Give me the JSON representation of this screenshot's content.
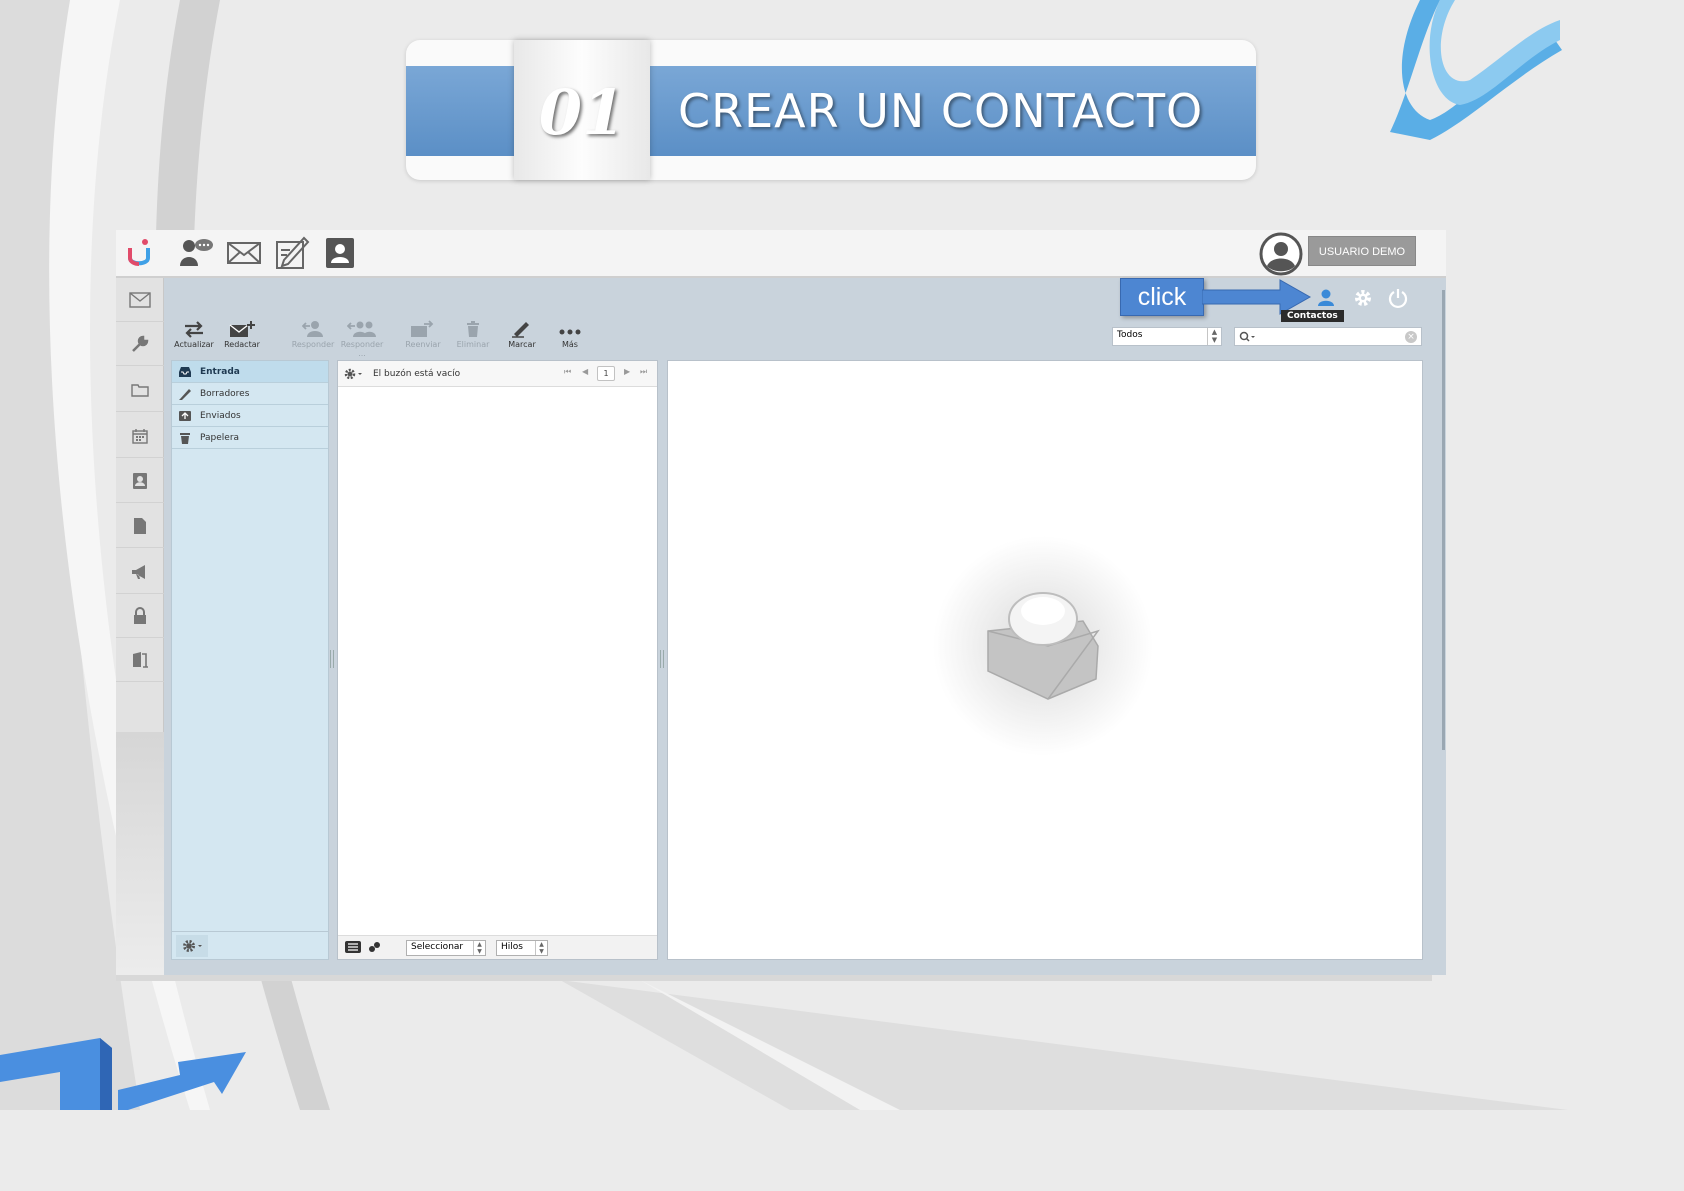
{
  "banner": {
    "number": "01",
    "title": "CREAR UN CONTACTO"
  },
  "topbar": {
    "icons": [
      "chat-icon",
      "mail-icon",
      "compose-icon",
      "addressbook-icon"
    ],
    "user_label": "USUARIO DEMO"
  },
  "rail": {
    "icons": [
      "mail-icon",
      "wrench-icon",
      "folder-icon",
      "calendar-icon",
      "contacts-icon",
      "file-icon",
      "megaphone-icon",
      "lock-icon",
      "logout-icon"
    ]
  },
  "callout": {
    "text": "click"
  },
  "header": {
    "tooltip": "Contactos"
  },
  "toolbar": {
    "buttons": [
      {
        "label": "Actualizar",
        "enabled": true
      },
      {
        "label": "Redactar",
        "enabled": true
      },
      {
        "label": "Responder",
        "enabled": false
      },
      {
        "label": "Responder ...",
        "enabled": false
      },
      {
        "label": "Reenviar",
        "enabled": false
      },
      {
        "label": "Eliminar",
        "enabled": false
      },
      {
        "label": "Marcar",
        "enabled": true
      },
      {
        "label": "Más",
        "enabled": true
      }
    ],
    "filter_value": "Todos"
  },
  "folders": [
    {
      "label": "Entrada",
      "active": true
    },
    {
      "label": "Borradores",
      "active": false
    },
    {
      "label": "Enviados",
      "active": false
    },
    {
      "label": "Papelera",
      "active": false
    }
  ],
  "msglist": {
    "status": "El buzón está vacío",
    "page": "1",
    "select_label": "Seleccionar",
    "threads_label": "Hilos"
  },
  "colors": {
    "accent": "#4d86d2",
    "banner_blue": "#6a9bd0",
    "folder_bg": "#d4e7f1"
  }
}
